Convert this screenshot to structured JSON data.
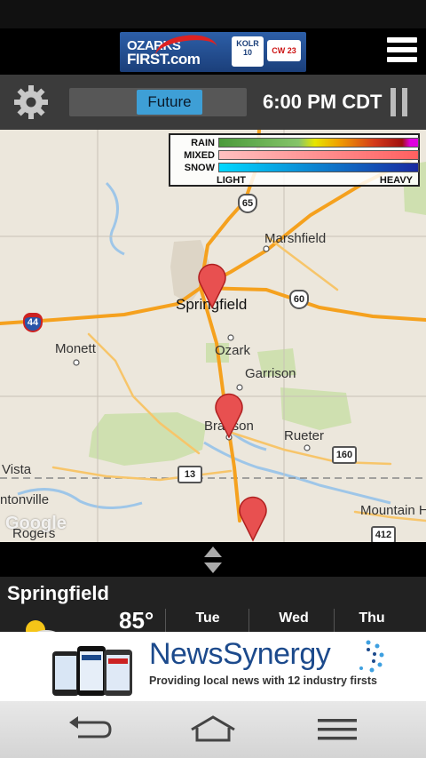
{
  "header": {
    "brand_primary": "OZARKS",
    "brand_secondary": "FIRST.com",
    "brand_badge": "KOLR 10",
    "brand_badge2": "CW 23",
    "menu_icon": "hamburger-menu-icon"
  },
  "toolbar": {
    "settings_icon": "gear-icon",
    "mode_label": "Future",
    "time": "6:00 PM CDT",
    "pause_icon": "pause-icon"
  },
  "legend": {
    "rows": [
      {
        "label": "RAIN"
      },
      {
        "label": "MIXED"
      },
      {
        "label": "SNOW"
      }
    ],
    "light_label": "LIGHT",
    "heavy_label": "HEAVY",
    "colors": {
      "rain": [
        "#4a9a3a",
        "#86c46a",
        "#e6e600",
        "#f0a000",
        "#d43a1a",
        "#a01010",
        "#e000e0"
      ],
      "mixed": [
        "#ffc0c0",
        "#ff6060"
      ],
      "snow": [
        "#00d8ff",
        "#1a2aa0"
      ]
    }
  },
  "map": {
    "places": [
      {
        "name": "Marshfield"
      },
      {
        "name": "Springfield"
      },
      {
        "name": "Monett"
      },
      {
        "name": "Ozark"
      },
      {
        "name": "Garrison"
      },
      {
        "name": "Branson"
      },
      {
        "name": "Rueter"
      },
      {
        "name": "Vista"
      },
      {
        "name": "ntonville"
      },
      {
        "name": "Rogers"
      },
      {
        "name": "Mountain H"
      }
    ],
    "highways": [
      "65",
      "60",
      "44",
      "160",
      "13",
      "412"
    ],
    "watermark": "Google"
  },
  "forecast": {
    "city": "Springfield",
    "current_temp": "85°",
    "current_icon": "partly-sunny-icon",
    "days": [
      "Tue",
      "Wed",
      "Thu"
    ]
  },
  "ad": {
    "title_a": "News",
    "title_b": "Synergy",
    "tagline": "Providing local news with 12 industry firsts"
  },
  "nav": {
    "back_icon": "back-icon",
    "home_icon": "home-icon",
    "menu_icon": "menu-icon"
  }
}
